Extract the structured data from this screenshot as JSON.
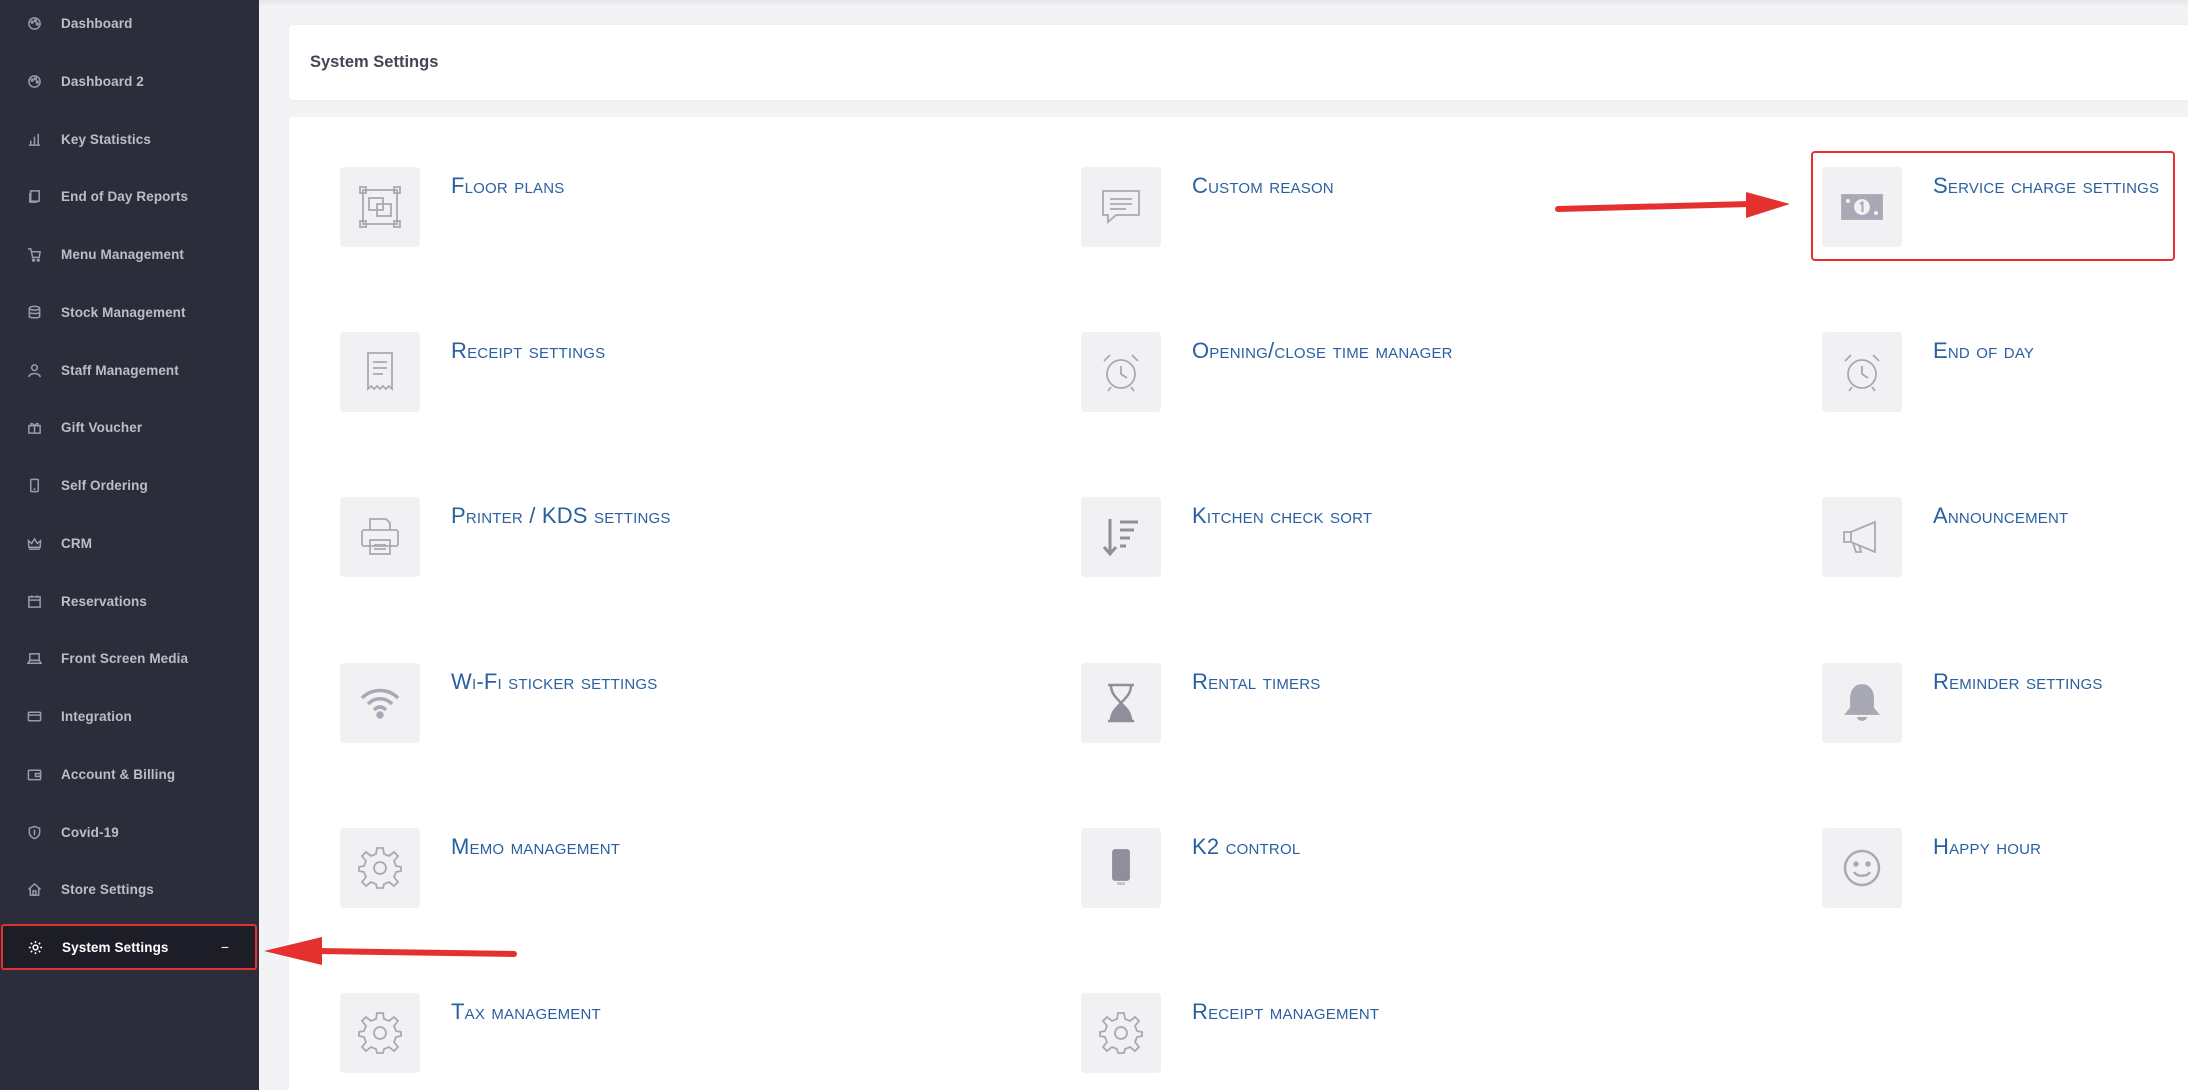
{
  "sidebar": {
    "items": [
      {
        "label": "Dashboard",
        "icon": "palette-icon"
      },
      {
        "label": "Dashboard 2",
        "icon": "palette-icon"
      },
      {
        "label": "Key Statistics",
        "icon": "bar-chart-icon"
      },
      {
        "label": "End of Day Reports",
        "icon": "documents-icon"
      },
      {
        "label": "Menu Management",
        "icon": "cart-icon"
      },
      {
        "label": "Stock Management",
        "icon": "database-icon"
      },
      {
        "label": "Staff Management",
        "icon": "user-icon"
      },
      {
        "label": "Gift Voucher",
        "icon": "gift-icon"
      },
      {
        "label": "Self Ordering",
        "icon": "tablet-icon"
      },
      {
        "label": "CRM",
        "icon": "crown-icon"
      },
      {
        "label": "Reservations",
        "icon": "calendar-icon"
      },
      {
        "label": "Front Screen Media",
        "icon": "laptop-icon"
      },
      {
        "label": "Integration",
        "icon": "credit-card-icon"
      },
      {
        "label": "Account & Billing",
        "icon": "wallet-icon"
      },
      {
        "label": "Covid-19",
        "icon": "shield-icon"
      },
      {
        "label": "Store Settings",
        "icon": "home-icon"
      },
      {
        "label": "System Settings",
        "icon": "gear-icon",
        "active": true,
        "collapse": "−"
      }
    ]
  },
  "header": {
    "title": "System Settings"
  },
  "tiles": [
    {
      "label": "Floor plans",
      "icon": "floor-plan-icon"
    },
    {
      "label": "Custom reason",
      "icon": "chat-icon"
    },
    {
      "label": "Service charge settings",
      "icon": "money-icon"
    },
    {
      "label": "Receipt settings",
      "icon": "receipt-icon"
    },
    {
      "label": "Opening/close time manager",
      "icon": "alarm-clock-icon"
    },
    {
      "label": "End of day",
      "icon": "alarm-clock-icon"
    },
    {
      "label": "Printer / KDS settings",
      "icon": "printer-icon"
    },
    {
      "label": "Kitchen check sort",
      "icon": "sort-icon"
    },
    {
      "label": "Announcement",
      "icon": "megaphone-icon"
    },
    {
      "label": "Wi-Fi sticker settings",
      "icon": "wifi-icon"
    },
    {
      "label": "Rental timers",
      "icon": "hourglass-icon"
    },
    {
      "label": "Reminder settings",
      "icon": "bell-icon"
    },
    {
      "label": "Memo management",
      "icon": "gear-icon"
    },
    {
      "label": "K2 control",
      "icon": "device-icon"
    },
    {
      "label": "Happy hour",
      "icon": "smiley-icon"
    },
    {
      "label": "Tax management",
      "icon": "gear-icon"
    },
    {
      "label": "Receipt management",
      "icon": "gear-icon"
    }
  ],
  "colors": {
    "accent": "#2a5fa0",
    "annotation": "#e53030",
    "sidebar": "#2c2c3b"
  }
}
